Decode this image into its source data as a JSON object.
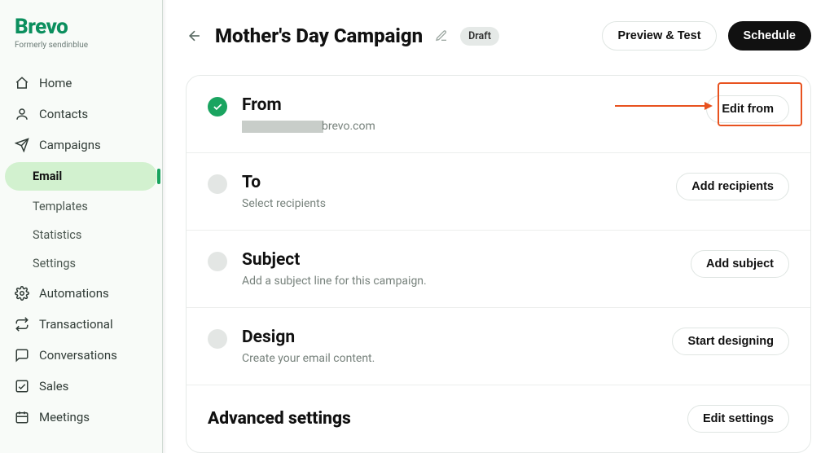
{
  "brand": {
    "name": "Brevo",
    "sub": "Formerly sendinblue"
  },
  "sidebar": {
    "items": [
      {
        "label": "Home"
      },
      {
        "label": "Contacts"
      },
      {
        "label": "Campaigns"
      },
      {
        "label": "Automations"
      },
      {
        "label": "Transactional"
      },
      {
        "label": "Conversations"
      },
      {
        "label": "Sales"
      },
      {
        "label": "Meetings"
      }
    ],
    "campaignSub": [
      {
        "label": "Email"
      },
      {
        "label": "Templates"
      },
      {
        "label": "Statistics"
      },
      {
        "label": "Settings"
      }
    ]
  },
  "header": {
    "title": "Mother's Day Campaign",
    "status": "Draft",
    "preview": "Preview & Test",
    "schedule": "Schedule"
  },
  "sections": {
    "from": {
      "title": "From",
      "domain": "brevo.com",
      "button": "Edit from"
    },
    "to": {
      "title": "To",
      "sub": "Select recipients",
      "button": "Add recipients"
    },
    "subject": {
      "title": "Subject",
      "sub": "Add a subject line for this campaign.",
      "button": "Add subject"
    },
    "design": {
      "title": "Design",
      "sub": "Create your email content.",
      "button": "Start designing"
    },
    "advanced": {
      "title": "Advanced settings",
      "button": "Edit settings"
    }
  }
}
